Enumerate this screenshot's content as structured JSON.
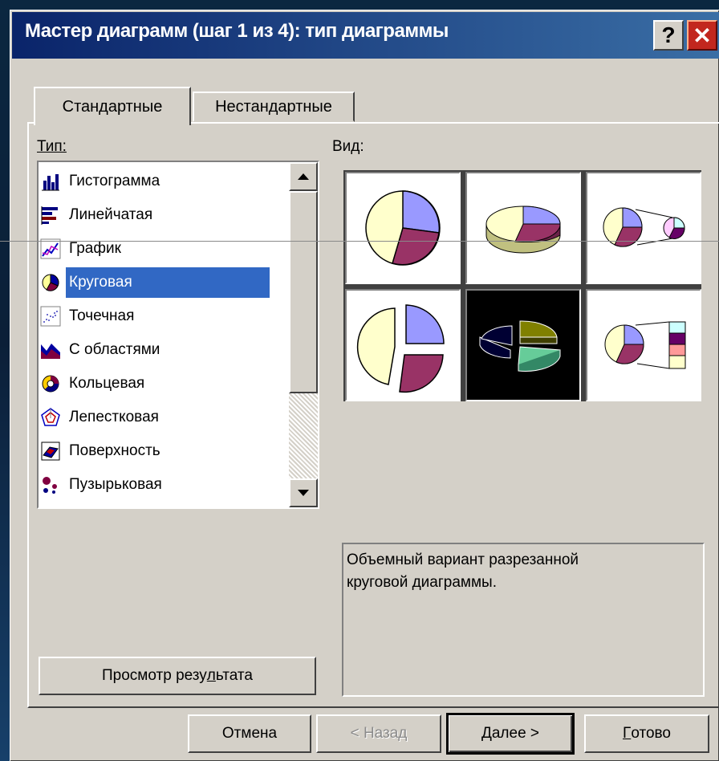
{
  "window": {
    "title": "Мастер диаграмм (шаг 1 из 4): тип диаграммы",
    "help_glyph": "?",
    "close_glyph": "✕"
  },
  "tabs": [
    {
      "label": "Стандартные",
      "active": true
    },
    {
      "label": "Нестандартные",
      "active": false
    }
  ],
  "type_label": "Тип:",
  "view_label": "Вид:",
  "chart_types": [
    {
      "label": "Гистограмма",
      "icon": "column-chart-icon"
    },
    {
      "label": "Линейчатая",
      "icon": "bar-chart-icon"
    },
    {
      "label": "График",
      "icon": "line-chart-icon"
    },
    {
      "label": "Круговая",
      "icon": "pie-chart-icon",
      "selected": true
    },
    {
      "label": "Точечная",
      "icon": "scatter-chart-icon"
    },
    {
      "label": "С областями",
      "icon": "area-chart-icon"
    },
    {
      "label": "Кольцевая",
      "icon": "doughnut-chart-icon"
    },
    {
      "label": "Лепестковая",
      "icon": "radar-chart-icon"
    },
    {
      "label": "Поверхность",
      "icon": "surface-chart-icon"
    },
    {
      "label": "Пузырьковая",
      "icon": "bubble-chart-icon"
    }
  ],
  "subtypes": [
    "pie-subtype-icon",
    "pie-3d-subtype-icon",
    "pie-of-pie-subtype-icon",
    "exploded-pie-subtype-icon",
    "exploded-pie-3d-subtype-icon",
    "bar-of-pie-subtype-icon"
  ],
  "selected_subtype": 4,
  "description": {
    "line1": "Объемный вариант разрезанной",
    "line2": "круговой диаграммы."
  },
  "preview_button": {
    "before": "Просмотр резу",
    "underlined": "л",
    "after": "ьтата"
  },
  "buttons": {
    "cancel": "Отмена",
    "back": "< Назад",
    "next": {
      "underlined": "Д",
      "rest": "алее >"
    },
    "finish": {
      "underlined": "Г",
      "rest": "отово"
    }
  },
  "colors": {
    "title_bar_start": "#0a246a",
    "title_bar_end": "#3a6ea5",
    "selection": "#3168c4",
    "pie_blue": "#9999ff",
    "pie_maroon": "#993366",
    "pie_cream": "#ffffcc"
  }
}
